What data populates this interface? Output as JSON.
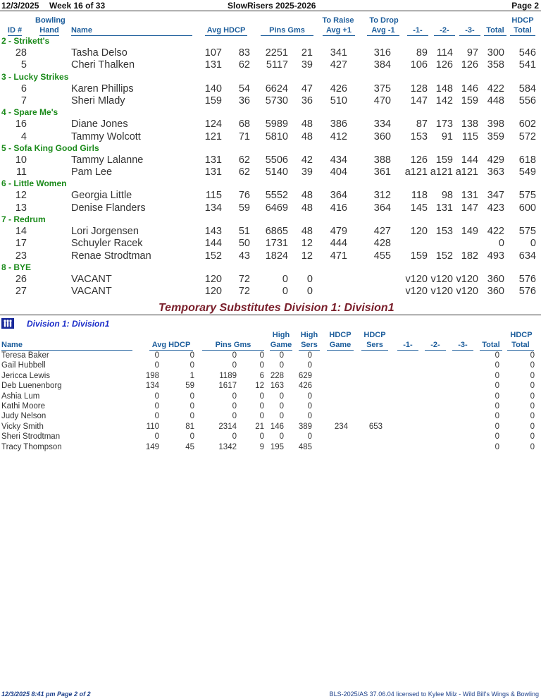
{
  "header": {
    "date": "12/3/2025",
    "week": "Week 16 of 33",
    "league": "SlowRisers 2025-2026",
    "page": "Page 2"
  },
  "bowler_columns": {
    "id": "ID #",
    "hand_top": "Bowling",
    "hand_bottom": "Hand",
    "name": "Name",
    "avg_hdcp": "Avg HDCP",
    "pins_gms": "Pins  Gms",
    "raise_top": "To Raise",
    "raise_bottom": "Avg +1",
    "drop_top": "To Drop",
    "drop_bottom": "Avg -1",
    "g1": "-1-",
    "g2": "-2-",
    "g3": "-3-",
    "total": "Total",
    "hdcp_top": "HDCP",
    "hdcp_bottom": "Total"
  },
  "teams": [
    {
      "name": "2 - Strikett's",
      "bowlers": [
        {
          "id": "28",
          "name": "Tasha Delso",
          "avg": "107",
          "hdcp": "83",
          "pins": "2251",
          "gms": "21",
          "raise": "341",
          "drop": "316",
          "g1": "89",
          "g2": "114",
          "g3": "97",
          "total": "300",
          "hdcp_total": "546"
        },
        {
          "id": "5",
          "name": "Cheri Thalken",
          "avg": "131",
          "hdcp": "62",
          "pins": "5117",
          "gms": "39",
          "raise": "427",
          "drop": "384",
          "g1": "106",
          "g2": "126",
          "g3": "126",
          "total": "358",
          "hdcp_total": "541"
        }
      ]
    },
    {
      "name": "3 - Lucky Strikes",
      "bowlers": [
        {
          "id": "6",
          "name": "Karen Phillips",
          "avg": "140",
          "hdcp": "54",
          "pins": "6624",
          "gms": "47",
          "raise": "426",
          "drop": "375",
          "g1": "128",
          "g2": "148",
          "g3": "146",
          "total": "422",
          "hdcp_total": "584"
        },
        {
          "id": "7",
          "name": "Sheri Mlady",
          "avg": "159",
          "hdcp": "36",
          "pins": "5730",
          "gms": "36",
          "raise": "510",
          "drop": "470",
          "g1": "147",
          "g2": "142",
          "g3": "159",
          "total": "448",
          "hdcp_total": "556"
        }
      ]
    },
    {
      "name": "4 - Spare Me's",
      "bowlers": [
        {
          "id": "16",
          "name": "Diane Jones",
          "avg": "124",
          "hdcp": "68",
          "pins": "5989",
          "gms": "48",
          "raise": "386",
          "drop": "334",
          "g1": "87",
          "g2": "173",
          "g3": "138",
          "total": "398",
          "hdcp_total": "602"
        },
        {
          "id": "4",
          "name": "Tammy Wolcott",
          "avg": "121",
          "hdcp": "71",
          "pins": "5810",
          "gms": "48",
          "raise": "412",
          "drop": "360",
          "g1": "153",
          "g2": "91",
          "g3": "115",
          "total": "359",
          "hdcp_total": "572"
        }
      ]
    },
    {
      "name": "5 - Sofa King Good Girls",
      "bowlers": [
        {
          "id": "10",
          "name": "Tammy Lalanne",
          "avg": "131",
          "hdcp": "62",
          "pins": "5506",
          "gms": "42",
          "raise": "434",
          "drop": "388",
          "g1": "126",
          "g2": "159",
          "g3": "144",
          "total": "429",
          "hdcp_total": "618"
        },
        {
          "id": "11",
          "name": "Pam Lee",
          "avg": "131",
          "hdcp": "62",
          "pins": "5140",
          "gms": "39",
          "raise": "404",
          "drop": "361",
          "g1": "a121",
          "g2": "a121",
          "g3": "a121",
          "total": "363",
          "hdcp_total": "549"
        }
      ]
    },
    {
      "name": "6 - Little Women",
      "bowlers": [
        {
          "id": "12",
          "name": "Georgia Little",
          "avg": "115",
          "hdcp": "76",
          "pins": "5552",
          "gms": "48",
          "raise": "364",
          "drop": "312",
          "g1": "118",
          "g2": "98",
          "g3": "131",
          "total": "347",
          "hdcp_total": "575"
        },
        {
          "id": "13",
          "name": "Denise Flanders",
          "avg": "134",
          "hdcp": "59",
          "pins": "6469",
          "gms": "48",
          "raise": "416",
          "drop": "364",
          "g1": "145",
          "g2": "131",
          "g3": "147",
          "total": "423",
          "hdcp_total": "600"
        }
      ]
    },
    {
      "name": "7 - Redrum",
      "bowlers": [
        {
          "id": "14",
          "name": "Lori Jorgensen",
          "avg": "143",
          "hdcp": "51",
          "pins": "6865",
          "gms": "48",
          "raise": "479",
          "drop": "427",
          "g1": "120",
          "g2": "153",
          "g3": "149",
          "total": "422",
          "hdcp_total": "575"
        },
        {
          "id": "17",
          "name": "Schuyler Racek",
          "avg": "144",
          "hdcp": "50",
          "pins": "1731",
          "gms": "12",
          "raise": "444",
          "drop": "428",
          "g1": "",
          "g2": "",
          "g3": "",
          "total": "0",
          "hdcp_total": "0"
        },
        {
          "id": "23",
          "name": "Renae Strodtman",
          "avg": "152",
          "hdcp": "43",
          "pins": "1824",
          "gms": "12",
          "raise": "471",
          "drop": "455",
          "g1": "159",
          "g2": "152",
          "g3": "182",
          "total": "493",
          "hdcp_total": "634"
        }
      ]
    },
    {
      "name": "8 - BYE",
      "bowlers": [
        {
          "id": "26",
          "name": "VACANT",
          "avg": "120",
          "hdcp": "72",
          "pins": "0",
          "gms": "0",
          "raise": "",
          "drop": "",
          "g1": "v120",
          "g2": "v120",
          "g3": "v120",
          "total": "360",
          "hdcp_total": "576"
        },
        {
          "id": "27",
          "name": "VACANT",
          "avg": "120",
          "hdcp": "72",
          "pins": "0",
          "gms": "0",
          "raise": "",
          "drop": "",
          "g1": "v120",
          "g2": "v120",
          "g3": "v120",
          "total": "360",
          "hdcp_total": "576"
        }
      ]
    }
  ],
  "subs_section": {
    "title": "Temporary Substitutes   Division 1: Division1",
    "division_label": "Division 1: Division1",
    "icon": "bowling-pins-icon"
  },
  "sub_columns": {
    "name": "Name",
    "avg_hdcp": "Avg HDCP",
    "pins_gms": "Pins  Gms",
    "hg_top": "High",
    "hg_bottom": "Game",
    "hs_top": "High",
    "hs_bottom": "Sers",
    "hdg_top": "HDCP",
    "hdg_bottom": "Game",
    "hds_top": "HDCP",
    "hds_bottom": "Sers",
    "g1": "-1-",
    "g2": "-2-",
    "g3": "-3-",
    "total": "Total",
    "hdcp_top": "HDCP",
    "hdcp_bottom": "Total"
  },
  "subs": [
    {
      "name": "Teresa Baker",
      "avg": "0",
      "hdcp": "0",
      "pins": "0",
      "gms": "0",
      "hg": "0",
      "hs": "0",
      "hdg": "",
      "hds": "",
      "total": "0",
      "hdcp_total": "0"
    },
    {
      "name": "Gail Hubbell",
      "avg": "0",
      "hdcp": "0",
      "pins": "0",
      "gms": "0",
      "hg": "0",
      "hs": "0",
      "hdg": "",
      "hds": "",
      "total": "0",
      "hdcp_total": "0"
    },
    {
      "name": "Jericca Lewis",
      "avg": "198",
      "hdcp": "1",
      "pins": "1189",
      "gms": "6",
      "hg": "228",
      "hs": "629",
      "hdg": "",
      "hds": "",
      "total": "0",
      "hdcp_total": "0"
    },
    {
      "name": "Deb Luenenborg",
      "avg": "134",
      "hdcp": "59",
      "pins": "1617",
      "gms": "12",
      "hg": "163",
      "hs": "426",
      "hdg": "",
      "hds": "",
      "total": "0",
      "hdcp_total": "0"
    },
    {
      "name": "Ashia Lum",
      "avg": "0",
      "hdcp": "0",
      "pins": "0",
      "gms": "0",
      "hg": "0",
      "hs": "0",
      "hdg": "",
      "hds": "",
      "total": "0",
      "hdcp_total": "0"
    },
    {
      "name": "Kathi Moore",
      "avg": "0",
      "hdcp": "0",
      "pins": "0",
      "gms": "0",
      "hg": "0",
      "hs": "0",
      "hdg": "",
      "hds": "",
      "total": "0",
      "hdcp_total": "0"
    },
    {
      "name": "Judy Nelson",
      "avg": "0",
      "hdcp": "0",
      "pins": "0",
      "gms": "0",
      "hg": "0",
      "hs": "0",
      "hdg": "",
      "hds": "",
      "total": "0",
      "hdcp_total": "0"
    },
    {
      "name": "Vicky Smith",
      "avg": "110",
      "hdcp": "81",
      "pins": "2314",
      "gms": "21",
      "hg": "146",
      "hs": "389",
      "hdg": "234",
      "hds": "653",
      "total": "0",
      "hdcp_total": "0"
    },
    {
      "name": "Sheri Strodtman",
      "avg": "0",
      "hdcp": "0",
      "pins": "0",
      "gms": "0",
      "hg": "0",
      "hs": "0",
      "hdg": "",
      "hds": "",
      "total": "0",
      "hdcp_total": "0"
    },
    {
      "name": "Tracy Thompson",
      "avg": "149",
      "hdcp": "45",
      "pins": "1342",
      "gms": "9",
      "hg": "195",
      "hs": "485",
      "hdg": "",
      "hds": "",
      "total": "0",
      "hdcp_total": "0"
    }
  ],
  "footer": {
    "left": "12/3/2025  8:41 pm  Page 2 of 2",
    "right": "BLS-2025/AS 37.06.04 licensed to Kylee Milz - Wild Bill's Wings & Bowling"
  },
  "colors": {
    "team": "#1a8a1a",
    "column_header": "#1c5d9b",
    "subs_title": "#7a1f2b",
    "division": "#1c2ec9"
  }
}
